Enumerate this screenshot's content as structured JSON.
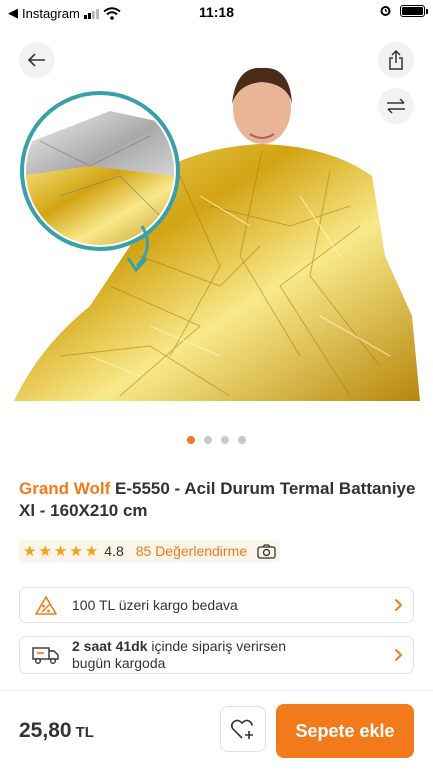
{
  "status_bar": {
    "back_app": "Instagram",
    "time": "11:18"
  },
  "gallery": {
    "page_count": 4,
    "active_index": 0
  },
  "product": {
    "brand": "Grand Wolf",
    "name": " E-5550 - Acil Durum Termal Battaniye Xl - 160X210 cm",
    "rating": {
      "stars": 4.8,
      "score_label": "4.8",
      "reviews_label": "85 Değerlendirme"
    }
  },
  "info_cards": {
    "shipping_free": {
      "text": "100 TL üzeri kargo bedava"
    },
    "fast_delivery": {
      "time": "2 saat 41dk",
      "text_rest": " içinde sipariş verirsen",
      "line2": "bugün kargoda"
    }
  },
  "footer": {
    "price": "25,80",
    "currency": "TL",
    "cart_label": "Sepete ekle"
  },
  "colors": {
    "accent": "#f27a1a",
    "star": "#f2a01a",
    "gold": "#d9b21c",
    "teal_ring": "#3aa0a8"
  }
}
